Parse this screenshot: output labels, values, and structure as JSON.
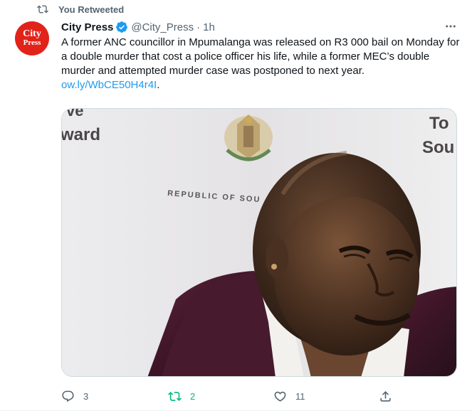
{
  "retweet_context": {
    "label": "You Retweeted"
  },
  "author": {
    "avatar_line1": "City",
    "avatar_line2": "Press",
    "name": "City Press",
    "handle": "@City_Press",
    "separator": "·",
    "time": "1h",
    "verified": true
  },
  "tweet": {
    "text": "A former ANC councillor in Mpumalanga was released on R3 000 bail on Monday for a double murder that cost a police officer his life, while a former MEC’s double murder and attempted murder case was postponed to next year. ",
    "link": "ow.ly/WbCE50H4r4I",
    "trailing": "."
  },
  "media": {
    "sign_left_top": "ve",
    "sign_left_bottom": "ward",
    "sign_right_top": "To",
    "sign_right_bottom": "Sou",
    "backdrop_text": "REPUBLIC OF SOU"
  },
  "actions": {
    "reply_count": "3",
    "retweet_count": "2",
    "like_count": "11",
    "retweeted": true
  },
  "colors": {
    "accent": "#1d9bf0",
    "retweet_active": "#00ba7c",
    "secondary_text": "#536471",
    "brand_red": "#e2231a"
  }
}
